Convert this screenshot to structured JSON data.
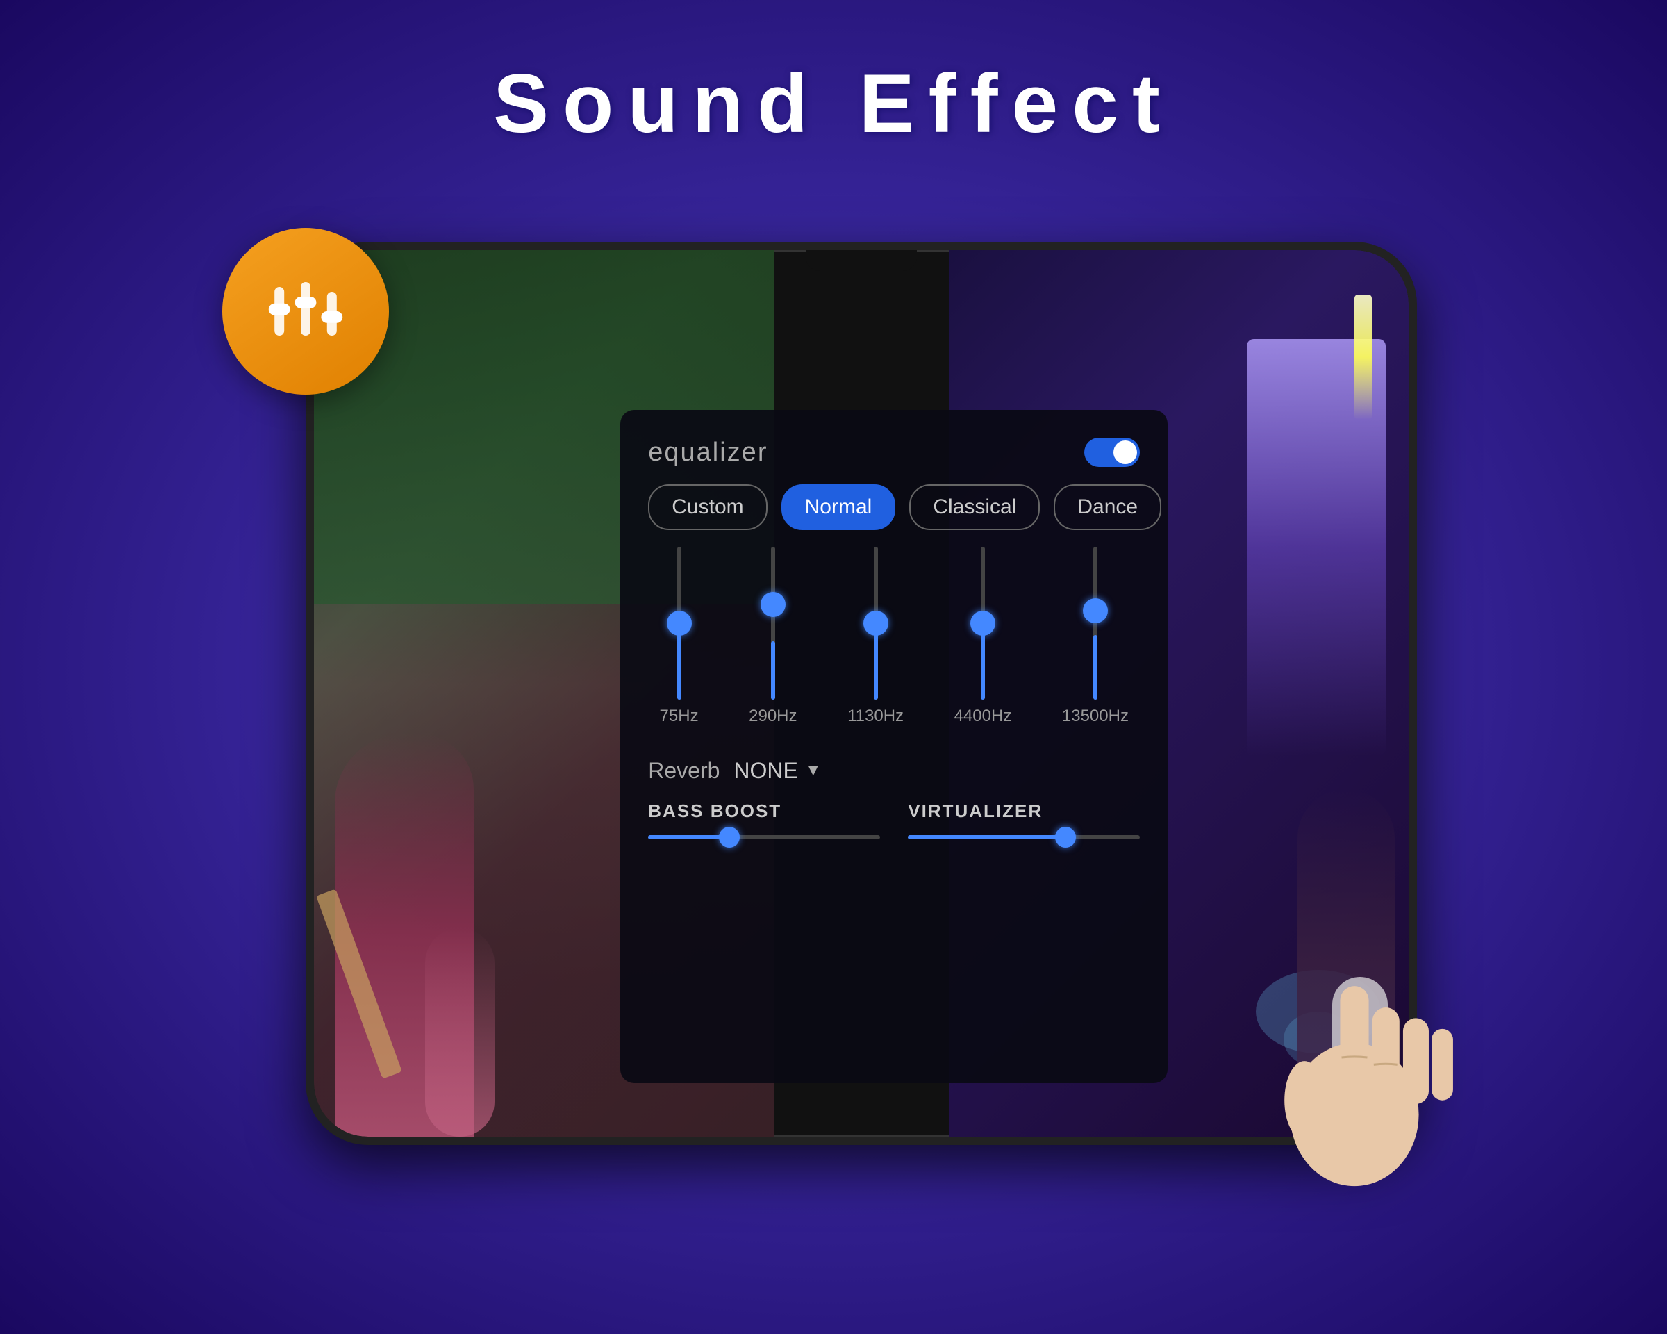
{
  "page": {
    "title": "Sound  Effect",
    "background_color": "#3a28a0"
  },
  "icon": {
    "label": "equalizer-icon",
    "bg_color": "#f5a020"
  },
  "equalizer": {
    "title": "equalizer",
    "toggle_on": true,
    "presets": [
      {
        "id": "custom",
        "label": "Custom",
        "active": false
      },
      {
        "id": "normal",
        "label": "Normal",
        "active": true
      },
      {
        "id": "classical",
        "label": "Classical",
        "active": false
      },
      {
        "id": "dance",
        "label": "Dance",
        "active": false
      }
    ],
    "sliders": [
      {
        "freq": "75Hz",
        "position_pct": 50
      },
      {
        "freq": "290Hz",
        "position_pct": 62
      },
      {
        "freq": "1130Hz",
        "position_pct": 50
      },
      {
        "freq": "4400Hz",
        "position_pct": 50
      },
      {
        "freq": "13500Hz",
        "position_pct": 58
      }
    ],
    "reverb": {
      "label": "Reverb",
      "value": "NONE"
    },
    "bass_boost": {
      "label": "BASS BOOST",
      "fill_pct": 35
    },
    "virtualizer": {
      "label": "VIRTUALIZER",
      "fill_pct": 68
    }
  }
}
